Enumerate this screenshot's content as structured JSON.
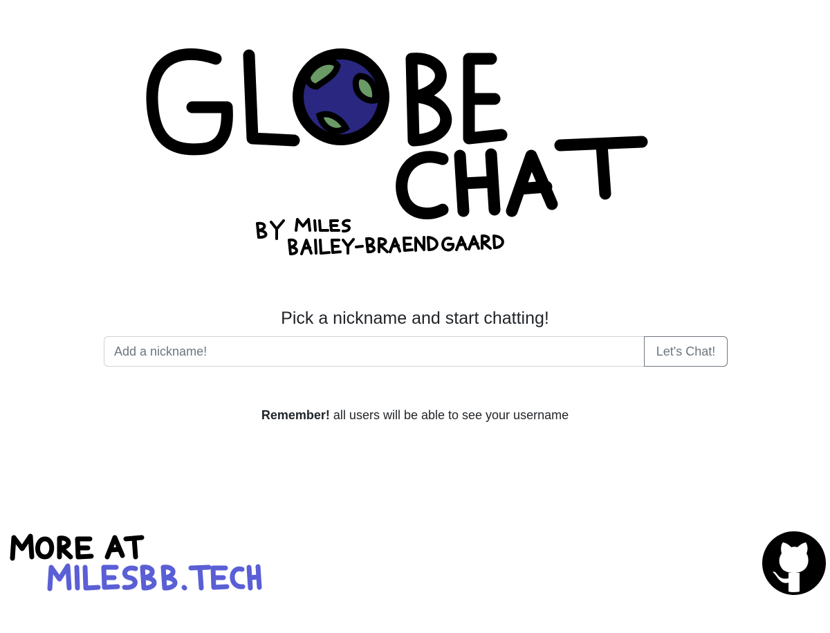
{
  "logo": {
    "line1": "GLOBE",
    "line2": "CHAT",
    "byline1": "BY MILES",
    "byline2": "BAILEY-BRAENDGAARD",
    "colors": {
      "ink": "#000000",
      "ocean": "#2a2780",
      "land": "#6a9a66"
    }
  },
  "prompt": "Pick a nickname and start chatting!",
  "form": {
    "nickname_placeholder": "Add a nickname!",
    "nickname_value": "",
    "submit_label": "Let's Chat!"
  },
  "reminder": {
    "bold": "Remember!",
    "text": " all users will be able to see your username"
  },
  "footer": {
    "more_label": "MORE AT",
    "site_label": "MILESBB.TECH",
    "site_color": "#5a5fd6",
    "github_icon": "github-icon"
  }
}
